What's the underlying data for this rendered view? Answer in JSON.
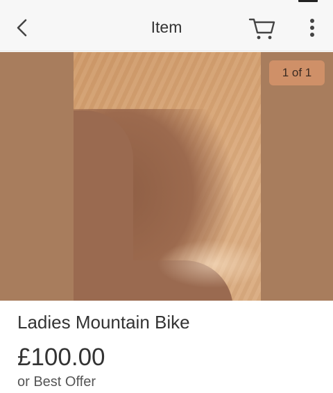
{
  "nav": {
    "title": "Item",
    "icons": {
      "back": "chevron-left-icon",
      "cart": "cart-icon",
      "more": "more-vertical-icon"
    }
  },
  "gallery": {
    "counter": "1 of 1"
  },
  "item": {
    "title": "Ladies Mountain Bike",
    "price": "£100.00",
    "offer": "or Best Offer"
  },
  "colors": {
    "nav_background": "#f7f7f7",
    "gallery_background": "#a87d5d",
    "badge_background": "#cf9068",
    "text": "#333333"
  }
}
